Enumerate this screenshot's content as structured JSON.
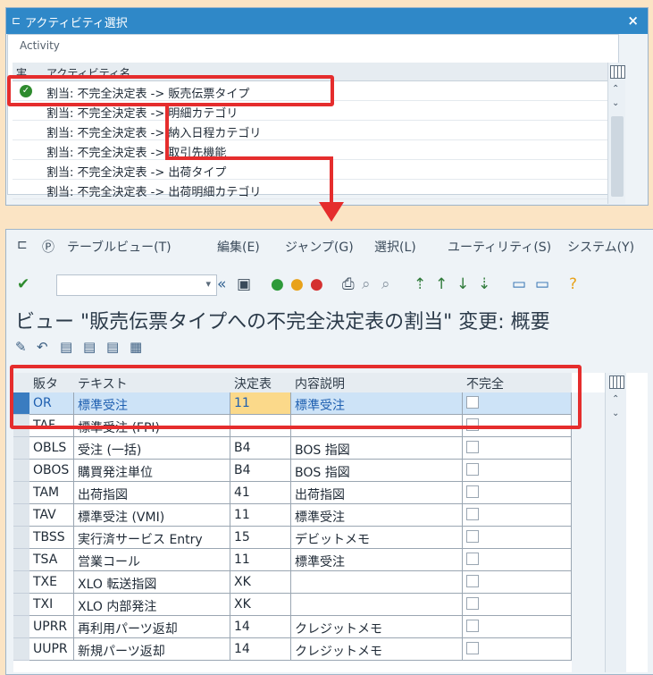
{
  "dialog": {
    "title": "アクティビティ選択",
    "close": "×",
    "group_label": "Activity",
    "col_exec": "実",
    "col_activity": "アクティビティ名",
    "rows": [
      {
        "text": "割当: 不完全決定表 -> 販売伝票タイプ",
        "done": true
      },
      {
        "text": "割当: 不完全決定表 -> 明細カテゴリ",
        "done": false
      },
      {
        "text": "割当: 不完全決定表 -> 納入日程カテゴリ",
        "done": false
      },
      {
        "text": "割当: 不完全決定表 -> 取引先機能",
        "done": false
      },
      {
        "text": "割当: 不完全決定表 -> 出荷タイプ",
        "done": false
      },
      {
        "text": "割当: 不完全決定表 -> 出荷明細カテゴリ",
        "done": false
      }
    ]
  },
  "menu": {
    "items": [
      "テーブルビュー(T)",
      "編集(E)",
      "ジャンプ(G)",
      "選択(L)",
      "ユーティリティ(S)",
      "システム(Y)"
    ]
  },
  "toolbar": {
    "command_placeholder": "",
    "icons": [
      "enter-icon",
      "save-icon",
      "back-icon",
      "exit-icon",
      "cancel-icon",
      "print-icon",
      "find-icon",
      "find-next-icon",
      "first-page-icon",
      "prev-page-icon",
      "next-page-icon",
      "last-page-icon",
      "new-session-icon",
      "shortcut-icon",
      "help-icon"
    ]
  },
  "page": {
    "title": "ビュー \"販売伝票タイプへの不完全決定表の割当\" 変更: 概要"
  },
  "table": {
    "headers": {
      "sd": "販タ",
      "text": "テキスト",
      "det": "決定表",
      "desc": "内容説明",
      "incomplete": "不完全"
    },
    "rows": [
      {
        "sd": "OR",
        "text": "標準受注",
        "det": "11",
        "desc": "標準受注",
        "incomplete": false
      },
      {
        "sd": "TAF",
        "text": "標準受注 (FPI)",
        "det": "",
        "desc": "",
        "incomplete": false
      },
      {
        "sd": "OBLS",
        "text": "受注 (一括)",
        "det": "B4",
        "desc": "BOS 指図",
        "incomplete": false
      },
      {
        "sd": "OBOS",
        "text": "購買発注単位",
        "det": "B4",
        "desc": "BOS 指図",
        "incomplete": false
      },
      {
        "sd": "TAM",
        "text": "出荷指図",
        "det": "41",
        "desc": "出荷指図",
        "incomplete": false
      },
      {
        "sd": "TAV",
        "text": "標準受注 (VMI)",
        "det": "11",
        "desc": "標準受注",
        "incomplete": false
      },
      {
        "sd": "TBSS",
        "text": "実行済サービス Entry",
        "det": "15",
        "desc": "デビットメモ",
        "incomplete": false
      },
      {
        "sd": "TSA",
        "text": "営業コール",
        "det": "11",
        "desc": "標準受注",
        "incomplete": false
      },
      {
        "sd": "TXE",
        "text": "XLO 転送指図",
        "det": "XK",
        "desc": "",
        "incomplete": false
      },
      {
        "sd": "TXI",
        "text": "XLO 内部発注",
        "det": "XK",
        "desc": "",
        "incomplete": false
      },
      {
        "sd": "UPRR",
        "text": "再利用パーツ返却",
        "det": "14",
        "desc": "クレジットメモ",
        "incomplete": false
      },
      {
        "sd": "UUPR",
        "text": "新規パーツ返却",
        "det": "14",
        "desc": "クレジットメモ",
        "incomplete": false
      }
    ]
  },
  "colors": {
    "accent": "#2f88c8",
    "annotation": "#e52d2d",
    "highlight_row": "#cde3f7",
    "highlight_cell": "#fbd98a"
  }
}
